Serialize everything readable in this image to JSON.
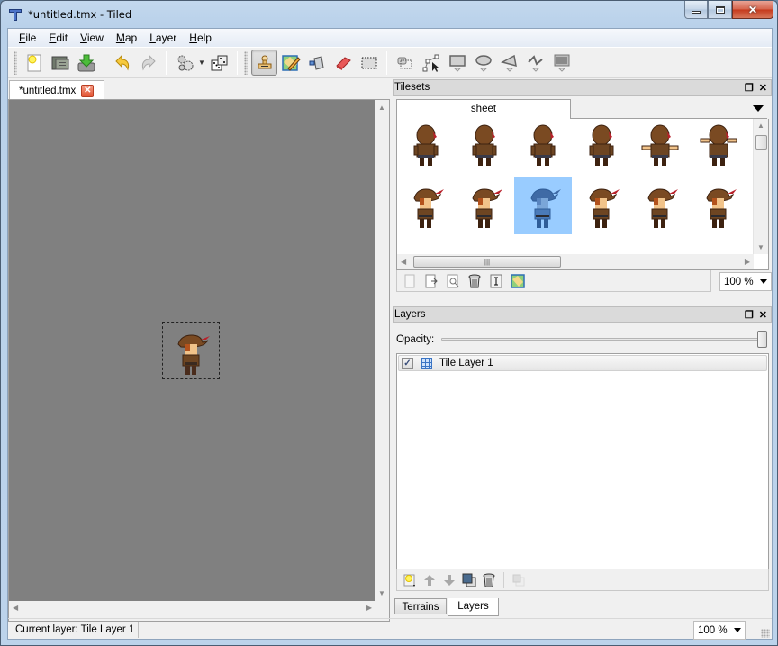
{
  "window": {
    "title": "*untitled.tmx - Tiled",
    "controls": {
      "minimize": "minimize",
      "maximize": "maximize",
      "close": "✕"
    }
  },
  "menubar": {
    "items": [
      {
        "label": "File",
        "accel": "F"
      },
      {
        "label": "Edit",
        "accel": "E"
      },
      {
        "label": "View",
        "accel": "V"
      },
      {
        "label": "Map",
        "accel": "M"
      },
      {
        "label": "Layer",
        "accel": "L"
      },
      {
        "label": "Help",
        "accel": "H"
      }
    ]
  },
  "toolbar": {
    "file_tools": [
      "new-map-icon",
      "open-icon",
      "save-icon"
    ],
    "edit_tools": [
      "undo-icon",
      "redo-icon"
    ],
    "command_tools": [
      "commands-gears-icon",
      "random-mode-dice-icon"
    ],
    "map_tools": [
      {
        "icon": "stamp-brush-icon",
        "active": true
      },
      {
        "icon": "terrain-brush-icon",
        "active": false
      },
      {
        "icon": "bucket-fill-icon",
        "active": false
      },
      {
        "icon": "eraser-icon",
        "active": false
      },
      {
        "icon": "rectangular-select-icon",
        "active": false
      }
    ],
    "object_tools": [
      "select-objects-icon",
      "edit-polygons-icon",
      "insert-rectangle-icon",
      "insert-ellipse-icon",
      "insert-polygon-icon",
      "insert-polyline-icon",
      "insert-tile-icon"
    ]
  },
  "document": {
    "tab_label": "*untitled.tmx",
    "tab_close": "✕"
  },
  "tilesets": {
    "title": "Tilesets",
    "tabs": [
      {
        "label": "sheet"
      }
    ],
    "selected_tile": {
      "row": 1,
      "col": 2
    },
    "zoom": "100 %",
    "toolbar": [
      "new-tileset-icon",
      "import-tileset-icon",
      "tileset-properties-icon",
      "remove-tileset-icon",
      "edit-terrain-icon",
      "tileset-image-icon"
    ]
  },
  "layers": {
    "title": "Layers",
    "opacity_label": "Opacity:",
    "opacity_value": 1.0,
    "items": [
      {
        "name": "Tile Layer 1",
        "visible": true,
        "type": "tile-layer"
      }
    ],
    "toolbar": [
      "add-layer-icon",
      "raise-layer-icon",
      "lower-layer-icon",
      "duplicate-layer-icon",
      "remove-layer-icon",
      "show-hide-others-icon"
    ]
  },
  "bottom_tabs": [
    {
      "label": "Terrains",
      "active": false
    },
    {
      "label": "Layers",
      "active": true
    }
  ],
  "statusbar": {
    "current_layer": "Current layer: Tile Layer 1",
    "zoom": "100 %"
  },
  "colors": {
    "canvas_bg": "#808080",
    "selection_highlight": "#99ccff",
    "active_tool_bg": "#d8d8d8"
  }
}
